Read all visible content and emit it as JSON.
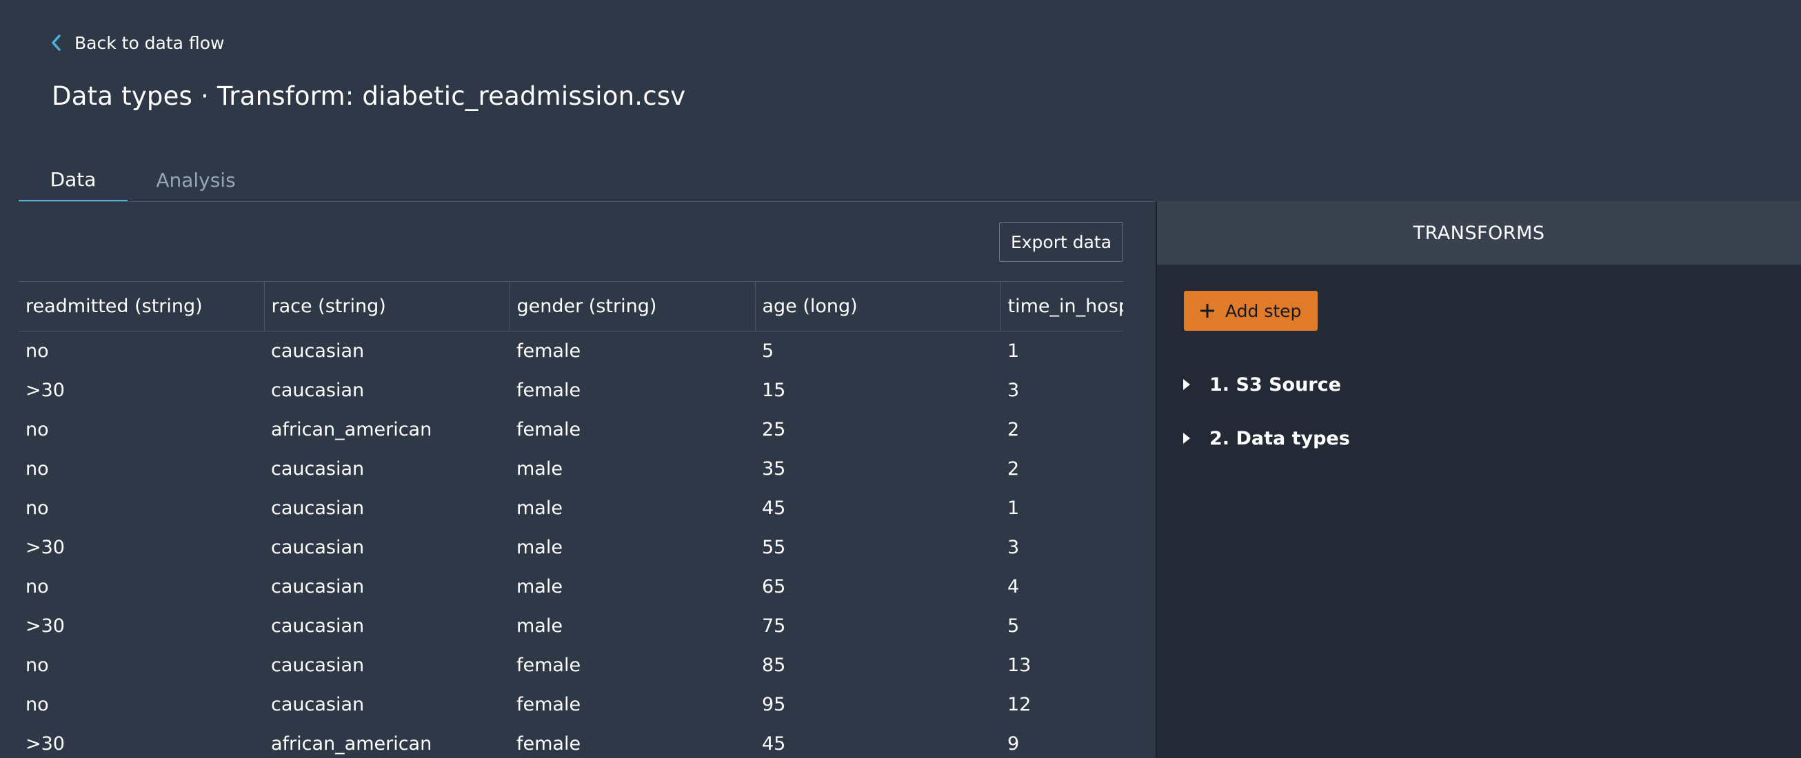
{
  "header": {
    "back_label": "Back to data flow",
    "title": "Data types · Transform: diabetic_readmission.csv"
  },
  "tabs": [
    {
      "label": "Data",
      "active": true
    },
    {
      "label": "Analysis",
      "active": false
    }
  ],
  "toolbar": {
    "export_label": "Export data"
  },
  "table": {
    "columns": [
      "readmitted (string)",
      "race (string)",
      "gender (string)",
      "age (long)",
      "time_in_hospital (long)"
    ],
    "rows": [
      [
        "no",
        "caucasian",
        "female",
        "5",
        "1"
      ],
      [
        ">30",
        "caucasian",
        "female",
        "15",
        "3"
      ],
      [
        "no",
        "african_american",
        "female",
        "25",
        "2"
      ],
      [
        "no",
        "caucasian",
        "male",
        "35",
        "2"
      ],
      [
        "no",
        "caucasian",
        "male",
        "45",
        "1"
      ],
      [
        ">30",
        "caucasian",
        "male",
        "55",
        "3"
      ],
      [
        "no",
        "caucasian",
        "male",
        "65",
        "4"
      ],
      [
        ">30",
        "caucasian",
        "male",
        "75",
        "5"
      ],
      [
        "no",
        "caucasian",
        "female",
        "85",
        "13"
      ],
      [
        "no",
        "caucasian",
        "female",
        "95",
        "12"
      ],
      [
        ">30",
        "african_american",
        "female",
        "45",
        "9"
      ]
    ]
  },
  "transforms": {
    "title": "TRANSFORMS",
    "add_step_label": "Add step",
    "steps": [
      {
        "label": "1. S3 Source"
      },
      {
        "label": "2. Data types"
      }
    ]
  },
  "colors": {
    "background": "#2f3847",
    "side_panel": "#232a35",
    "accent_tab": "#4db3d8",
    "add_step_button": "#e07b29"
  },
  "icons": {
    "back": "chevron-left-icon",
    "add": "plus-icon",
    "expand": "caret-right-icon"
  }
}
